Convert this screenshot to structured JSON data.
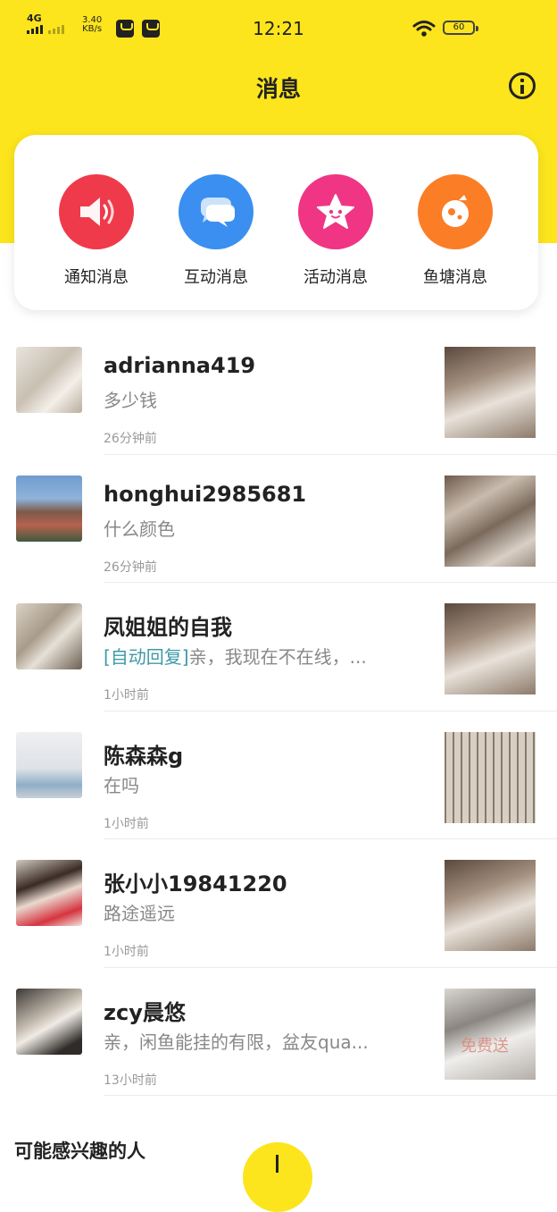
{
  "status_bar": {
    "network": "4G",
    "speed_value": "3.40",
    "speed_unit": "KB/s",
    "time": "12:21",
    "battery": "60"
  },
  "header": {
    "title": "消息"
  },
  "icons": {
    "info": "info-icon",
    "notice": "speaker-icon",
    "interact": "chat-bubbles-icon",
    "activity": "star-icon",
    "pond": "fish-icon"
  },
  "colors": {
    "brand_yellow": "#fce51c",
    "notice": "#ee3a4a",
    "interact": "#3b8ff0",
    "activity": "#ef3583",
    "pond": "#fb7d26",
    "auto_reply_tag": "#3d9aa6"
  },
  "categories": [
    {
      "label": "通知消息"
    },
    {
      "label": "互动消息"
    },
    {
      "label": "活动消息"
    },
    {
      "label": "鱼塘消息"
    }
  ],
  "conversations": [
    {
      "name": "adrianna419",
      "message": "多少钱",
      "time": "26分钟前"
    },
    {
      "name": "honghui2985681",
      "message": "什么颜色",
      "time": "26分钟前"
    },
    {
      "name": "凤姐姐的自我",
      "tag": "[自动回复]",
      "message": "亲，我现在不在线，...",
      "time": "1小时前"
    },
    {
      "name": "陈森森g",
      "message": "在吗",
      "time": "1小时前"
    },
    {
      "name": "张小小19841220",
      "message": "路途遥远",
      "time": "1小时前"
    },
    {
      "name": "zcy晨悠",
      "message": "亲，闲鱼能挂的有限，盆友qua...",
      "time": "13小时前",
      "thumb_text": "免费送"
    }
  ],
  "section": {
    "title": "可能感兴趣的人"
  }
}
